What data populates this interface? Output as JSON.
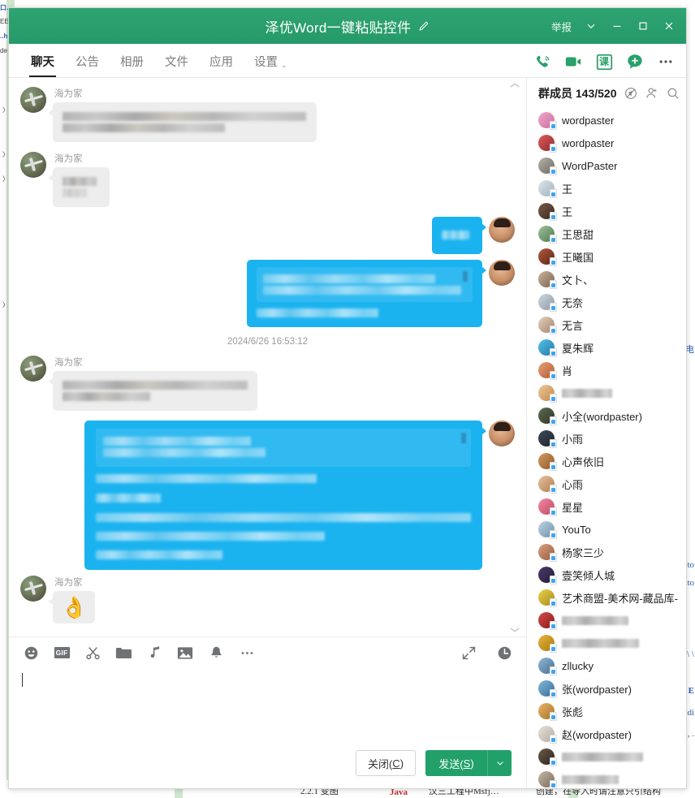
{
  "window": {
    "title": "泽优Word一键粘贴控件",
    "edit_icon": "pencil-icon",
    "report_label": "举报",
    "minimize_label": "−",
    "maximize_label": "□",
    "close_label": "✕",
    "chevron_label": "⌄"
  },
  "tabs": [
    {
      "label": "聊天",
      "active": true
    },
    {
      "label": "公告",
      "active": false
    },
    {
      "label": "相册",
      "active": false
    },
    {
      "label": "文件",
      "active": false
    },
    {
      "label": "应用",
      "active": false
    },
    {
      "label": "设置",
      "active": false,
      "caret": "⌄"
    }
  ],
  "header_actions": [
    {
      "name": "voice-call-icon"
    },
    {
      "name": "video-call-icon"
    },
    {
      "name": "class-icon",
      "label": "课"
    },
    {
      "name": "add-bubble-icon"
    },
    {
      "name": "more-actions-icon"
    }
  ],
  "messages": [
    {
      "type": "them",
      "sender": "海为家",
      "lines": [
        88,
        60
      ],
      "kind": "redacted"
    },
    {
      "type": "them",
      "sender": "海为家",
      "lines": [
        40,
        32
      ],
      "kind": "redacted"
    },
    {
      "type": "me",
      "sender": "",
      "lines": [
        30
      ],
      "kind": "redacted"
    },
    {
      "type": "me",
      "sender": "",
      "code_lines": [
        78,
        72
      ],
      "lines": [
        52
      ],
      "kind": "redacted"
    },
    {
      "type": "timestamp",
      "text": "2024/6/26 16:53:12"
    },
    {
      "type": "them",
      "sender": "海为家",
      "lines": [
        62,
        74
      ],
      "kind": "redacted"
    },
    {
      "type": "me",
      "sender": "",
      "code_lines": [
        48,
        52
      ],
      "lines": [
        62,
        26,
        100,
        80,
        42
      ],
      "kind": "redacted"
    },
    {
      "type": "them",
      "sender": "海为家",
      "emoji": "👌",
      "kind": "emoji"
    }
  ],
  "composer": {
    "tools": [
      {
        "name": "emoji-icon"
      },
      {
        "name": "gif-icon",
        "label": "GIF"
      },
      {
        "name": "screenshot-scissors-icon"
      },
      {
        "name": "folder-icon"
      },
      {
        "name": "audio-message-icon"
      },
      {
        "name": "image-icon"
      },
      {
        "name": "bell-shake-icon"
      },
      {
        "name": "more-tools-icon"
      }
    ],
    "right_tools": [
      {
        "name": "expand-icon"
      },
      {
        "name": "chat-history-icon"
      }
    ],
    "input_value": "",
    "input_placeholder": "",
    "close_button": "关闭(C)",
    "close_button_text": "关闭(",
    "close_button_key": "C",
    "close_button_tail": ")",
    "send_button": "发送(S)",
    "send_button_text": "发送(",
    "send_button_key": "S",
    "send_button_tail": ")",
    "send_caret": "⌄"
  },
  "members": {
    "title": "群成员 143/520",
    "count_current": 143,
    "count_total": 520,
    "head_icons": [
      {
        "name": "mute-icon"
      },
      {
        "name": "add-member-icon"
      },
      {
        "name": "search-icon"
      }
    ],
    "items": [
      {
        "name": "wordpaster",
        "redacted": false
      },
      {
        "name": "wordpaster",
        "redacted": false
      },
      {
        "name": "WordPaster",
        "redacted": false
      },
      {
        "name": "王",
        "redacted": false
      },
      {
        "name": "王",
        "redacted": false
      },
      {
        "name": "王思甜",
        "redacted": false
      },
      {
        "name": "王曦国",
        "redacted": false
      },
      {
        "name": "文卜、",
        "redacted": false
      },
      {
        "name": "无奈",
        "redacted": false
      },
      {
        "name": "无言",
        "redacted": false
      },
      {
        "name": "夏朱辉",
        "redacted": false
      },
      {
        "name": "肖",
        "redacted": false
      },
      {
        "name": "",
        "redacted": true,
        "width": 62
      },
      {
        "name": "小全(wordpaster)",
        "redacted": false
      },
      {
        "name": "小雨",
        "redacted": false
      },
      {
        "name": "心声依旧",
        "redacted": false
      },
      {
        "name": "心雨",
        "redacted": false
      },
      {
        "name": "星星",
        "redacted": false
      },
      {
        "name": "YouTo",
        "redacted": false
      },
      {
        "name": "杨家三少",
        "redacted": false
      },
      {
        "name": "壹笑倾人城",
        "redacted": false
      },
      {
        "name": "艺术商盟-美术网-藏品库-",
        "redacted": false
      },
      {
        "name": "",
        "redacted": true,
        "width": 82
      },
      {
        "name": "",
        "redacted": true,
        "width": 95
      },
      {
        "name": "zllucky",
        "redacted": false
      },
      {
        "name": "张(wordpaster)",
        "redacted": false
      },
      {
        "name": "张彪",
        "redacted": false
      },
      {
        "name": "赵(wordpaster)",
        "redacted": false
      },
      {
        "name": "",
        "redacted": true,
        "width": 100
      },
      {
        "name": "",
        "redacted": true,
        "width": 70
      }
    ]
  },
  "colors": {
    "brand_green": "#26996a",
    "send_green": "#21a06a",
    "bubble_me": "#1ab3f0",
    "bubble_them": "#ededed",
    "desktop_green": "#cfe6cf"
  },
  "background": {
    "left_fragments": [
      "口…",
      "EE",
      "..h",
      "de",
      "〉",
      "〉",
      "〉",
      "〉"
    ],
    "right_fragments": [
      "电",
      "to",
      "to",
      "\\ \\",
      "E",
      "di",
      ", ."
    ],
    "bottom_fragments": [
      "2.2.1 变图",
      "Java",
      "汶三工程中Msfj…",
      "创建，在导入时请注意只引结构"
    ]
  }
}
